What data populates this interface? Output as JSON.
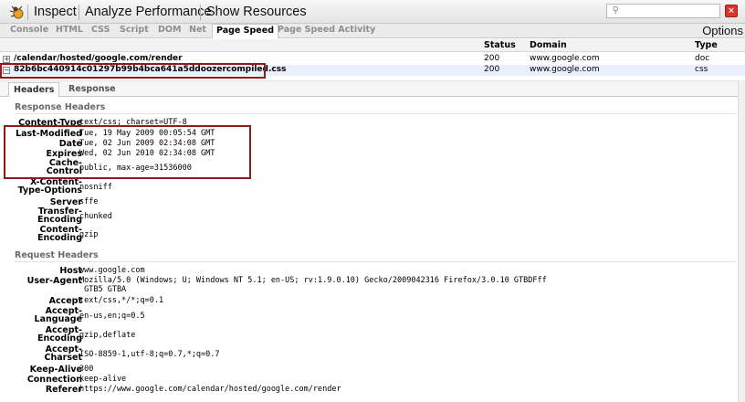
{
  "toolbar": {
    "items": [
      "Inspect",
      "Analyze Performance",
      "Show Resources"
    ]
  },
  "tabs": {
    "items": [
      "Console",
      "HTML",
      "CSS",
      "Script",
      "DOM",
      "Net",
      "Page Speed",
      "Page Speed Activity"
    ],
    "active": "Page Speed",
    "options_label": "Options"
  },
  "net": {
    "columns": [
      "Status",
      "Domain",
      "Type"
    ],
    "rows": [
      {
        "toggle": "+",
        "url": "/calendar/hosted/google.com/render",
        "status": "200",
        "domain": "www.google.com",
        "type": "doc"
      },
      {
        "toggle": "−",
        "url": "82b6bc440914c01297b99b4bca641a5ddoozercompiled.css",
        "status": "200",
        "domain": "www.google.com",
        "type": "css"
      }
    ]
  },
  "detail": {
    "tabs": [
      "Headers",
      "Response"
    ],
    "response_headers_title": "Response Headers",
    "request_headers_title": "Request Headers",
    "response_headers": [
      {
        "k": "Content-Type",
        "v": "text/css; charset=UTF-8"
      },
      {
        "k": "Last-Modified",
        "v": "Tue, 19 May 2009 00:05:54 GMT"
      },
      {
        "k": "Date",
        "v": "Tue, 02 Jun 2009 02:34:08 GMT"
      },
      {
        "k": "Expires",
        "v": "Wed, 02 Jun 2010 02:34:08 GMT"
      },
      {
        "k": "Cache-\nControl",
        "v": "public, max-age=31536000"
      },
      {
        "k": "X-Content-\nType-Options",
        "v": "nosniff"
      },
      {
        "k": "Server",
        "v": "sffe"
      },
      {
        "k": "Transfer-\nEncoding",
        "v": "chunked"
      },
      {
        "k": "Content-\nEncoding",
        "v": "gzip"
      }
    ],
    "request_headers": [
      {
        "k": "Host",
        "v": "www.google.com"
      },
      {
        "k": "User-Agent",
        "v": "Mozilla/5.0 (Windows; U; Windows NT 5.1; en-US; rv:1.9.0.10) Gecko/2009042316 Firefox/3.0.10 GTBDFff\n GTB5 GTBA"
      },
      {
        "k": "Accept",
        "v": "text/css,*/*;q=0.1"
      },
      {
        "k": "Accept-\nLanguage",
        "v": "en-us,en;q=0.5"
      },
      {
        "k": "Accept-\nEncoding",
        "v": "gzip,deflate"
      },
      {
        "k": "Accept-\nCharset",
        "v": "ISO-8859-1,utf-8;q=0.7,*;q=0.7"
      },
      {
        "k": "Keep-Alive",
        "v": "300"
      },
      {
        "k": "Connection",
        "v": "keep-alive"
      },
      {
        "k": "Referer",
        "v": "https://www.google.com/calendar/hosted/google.com/render"
      }
    ]
  },
  "colors": {
    "highlight_border": "#8f1b1b",
    "selected_row": "#eaf0fb",
    "close_button": "#d9362b"
  }
}
